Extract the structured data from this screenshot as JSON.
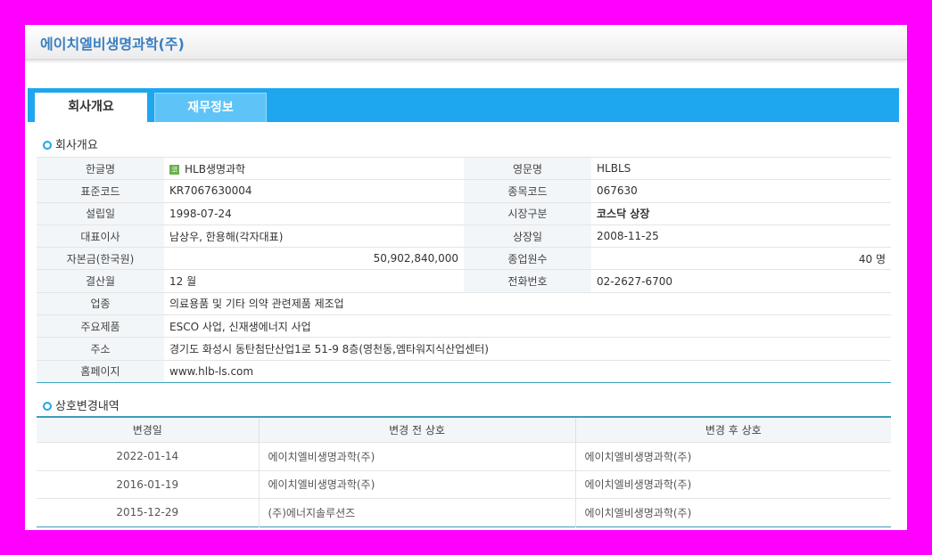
{
  "header": {
    "title": "에이치엘비생명과학(주)"
  },
  "tabs": [
    {
      "label": "회사개요",
      "active": true
    },
    {
      "label": "재무정보",
      "active": false
    }
  ],
  "overview": {
    "section_title": "회사개요",
    "korean_name_label": "한글명",
    "korean_name_badge": "코",
    "korean_name": "HLB생명과학",
    "english_name_label": "영문명",
    "english_name": "HLBLS",
    "std_code_label": "표준코드",
    "std_code": "KR7067630004",
    "ticker_label": "종목코드",
    "ticker": "067630",
    "founded_label": "설립일",
    "founded": "1998-07-24",
    "market_label": "시장구분",
    "market": "코스닥 상장",
    "ceo_label": "대표이사",
    "ceo": "남상우, 한용해(각자대표)",
    "listed_label": "상장일",
    "listed": "2008-11-25",
    "capital_label": "자본금(한국원)",
    "capital": "50,902,840,000",
    "employees_label": "종업원수",
    "employees": "40 명",
    "fiscal_label": "결산월",
    "fiscal": "12 월",
    "phone_label": "전화번호",
    "phone": "02-2627-6700",
    "industry_label": "업종",
    "industry": "의료용품 및 기타 의약 관련제품 제조업",
    "products_label": "주요제품",
    "products": "ESCO 사업, 신재생에너지 사업",
    "address_label": "주소",
    "address": "경기도 화성시 동탄첨단산업1로 51-9 8층(영천동,엠타워지식산업센터)",
    "homepage_label": "홈페이지",
    "homepage": "www.hlb-ls.com"
  },
  "history": {
    "section_title": "상호변경내역",
    "columns": [
      "변경일",
      "변경 전 상호",
      "변경 후 상호"
    ],
    "rows": [
      [
        "2022-01-14",
        "에이치엘비생명과학(주)",
        "에이치엘비생명과학(주)"
      ],
      [
        "2016-01-19",
        "에이치엘비생명과학(주)",
        "에이치엘비생명과학(주)"
      ],
      [
        "2015-12-29",
        "(주)에너지솔루션즈",
        "에이치엘비생명과학(주)"
      ]
    ]
  }
}
